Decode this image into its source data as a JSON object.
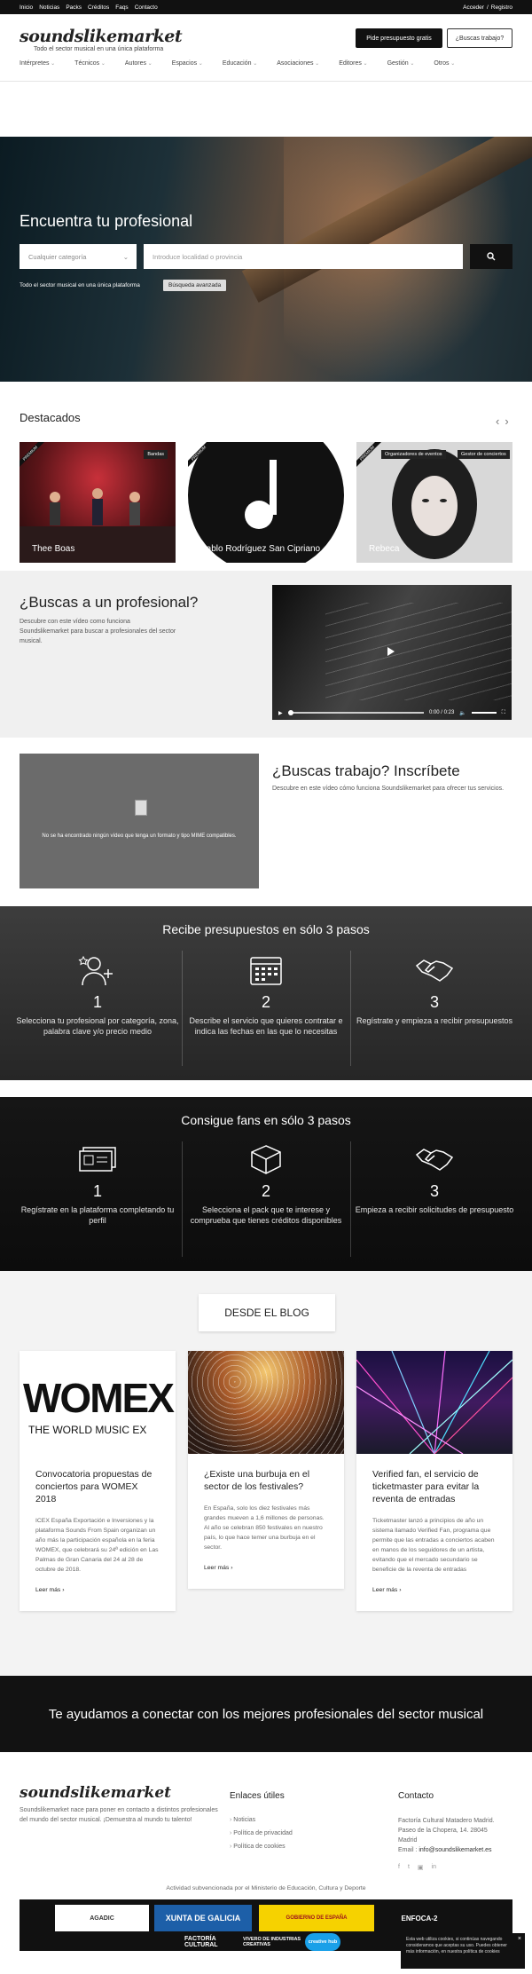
{
  "topbar": {
    "links": [
      "Inicio",
      "Noticias",
      "Packs",
      "Créditos",
      "Faqs",
      "Contacto"
    ],
    "access": "Acceder",
    "separator": "/",
    "register": "Registro"
  },
  "header": {
    "logo": "soundslikemarket",
    "tagline": "Todo el sector musical en una única plataforma",
    "quote_button": "Pide presupuesto gratis",
    "job_button": "¿Buscas trabajo?",
    "nav": [
      "Intérpretes",
      "Técnicos",
      "Autores",
      "Espacios",
      "Educación",
      "Asociaciones",
      "Editores",
      "Gestión",
      "Otros"
    ]
  },
  "hero": {
    "title": "Encuentra tu profesional",
    "category_placeholder": "Cualquier categoría",
    "location_placeholder": "Introduce localidad o provincia",
    "subtitle": "Todo el sector musical en una única plataforma",
    "advanced": "Búsqueda avanzada"
  },
  "featured": {
    "title": "Destacados",
    "cards": [
      {
        "name": "Thee Boas",
        "tags": [
          "Bandas"
        ],
        "badge": "PREMIUM"
      },
      {
        "name": "Pablo Rodríguez San Cipriano",
        "tags": [],
        "badge": "PREMIUM"
      },
      {
        "name": "Rebeca",
        "tags": [
          "Organizadores de eventos",
          "Gestor de conciertos"
        ],
        "badge": "PREMIUM"
      }
    ]
  },
  "find_pro": {
    "title": "¿Buscas a un profesional?",
    "text": "Descubre con este vídeo como funciona Soundslikemarket para buscar a profesionales del sector musical.",
    "video_time": "0:00 / 0:23"
  },
  "find_job": {
    "title": "¿Buscas trabajo? Inscríbete",
    "text": "Descubre en este vídeo cómo funciona Soundslikemarket para ofrecer tus servicios.",
    "video_error": "No se ha encontrado ningún vídeo que tenga un formato y tipo MIME compatibles."
  },
  "quotes_steps": {
    "title": "Recibe presupuestos en sólo 3 pasos",
    "steps": [
      {
        "num": "1",
        "icon": "person-star-icon",
        "text": "Selecciona tu profesional por categoría, zona, palabra clave y/o precio medio"
      },
      {
        "num": "2",
        "icon": "calendar-icon",
        "text": "Describe el servicio que quieres contratar e indica las fechas en las que lo necesitas"
      },
      {
        "num": "3",
        "icon": "handshake-icon",
        "text": "Regístrate y empieza a recibir presupuestos"
      }
    ]
  },
  "fans_steps": {
    "title": "Consigue fans en sólo 3 pasos",
    "steps": [
      {
        "num": "1",
        "icon": "id-card-icon",
        "text": "Regístrate en la plataforma completando tu perfil"
      },
      {
        "num": "2",
        "icon": "box-icon",
        "text": "Selecciona el pack que te interese y comprueba que tienes créditos disponibles"
      },
      {
        "num": "3",
        "icon": "handshake-icon",
        "text": "Empieza a recibir solicitudes de presupuesto"
      }
    ]
  },
  "blog": {
    "title": "DESDE EL BLOG",
    "posts": [
      {
        "title": "Convocatoria propuestas de conciertos para WOMEX 2018",
        "excerpt": "ICEX España Exportación e Inversiones y la plataforma Sounds From Spain organizan un año más la participación española en la feria WOMEX, que celebrará su 24ª edición en Las Palmas de Gran Canaria del 24 al 28 de octubre de 2018.",
        "more": "Leer más",
        "image_text": "WOMEX",
        "image_sub": "THE WORLD MUSIC EX"
      },
      {
        "title": "¿Existe una burbuja en el sector de los festivales?",
        "excerpt": "En España, solo los diez festivales más grandes mueven a 1,6 millones de personas. Al año se celebran 850 festivales en nuestro país, lo que hace temer una burbuja en el sector.",
        "more": "Leer más"
      },
      {
        "title": "Verified fan, el servicio de ticketmaster para evitar la reventa de entradas",
        "excerpt": "Ticketmaster lanzó a principios de año un sistema llamado Verified Fan, programa que permite que las entradas a conciertos acaben en manos de los seguidores de un artista, evitando que el mercado secundario se beneficie de la reventa de entradas",
        "more": "Leer más"
      }
    ]
  },
  "cta": {
    "text": "Te ayudamos a conectar con los mejores profesionales del sector musical"
  },
  "footer": {
    "logo": "soundslikemarket",
    "description": "Soundslikemarket nace para poner en contacto a distintos profesionales del mundo del sector musical. ¡Demuestra al mundo tu talento!",
    "links_title": "Enlaces útiles",
    "links": [
      "Noticias",
      "Política de privacidad",
      "Política de cookies"
    ],
    "contact_title": "Contacto",
    "contact_lines": [
      "Factoría Cultural Matadero Madrid.",
      "Paseo de la Chopera, 14. 28045",
      "Madrid"
    ],
    "email_label": "Email :",
    "email": "info@soundslikemarket.es",
    "social": [
      "f",
      "t",
      "▣",
      "in"
    ],
    "subsidy": "Actividad subvencionada por el Ministerio de Educación, Cultura y Deporte",
    "sponsors": [
      "AGADIC",
      "XUNTA DE GALICIA",
      "GOBIERNO DE ESPAÑA",
      "ENFOCA-2",
      "FACTORÍA CULTURAL",
      "VIVERO DE INDUSTRIAS CREATIVAS",
      "creative hub"
    ]
  },
  "cookie": {
    "text": "Esta web utiliza cookies, si continúas navegando consideramos que aceptas su uso. Puedes obtener más información, en nuestra política de cookies",
    "close": "×"
  },
  "colors": {
    "dark": "#111111",
    "light_bg": "#f0f0f0",
    "white": "#ffffff"
  }
}
